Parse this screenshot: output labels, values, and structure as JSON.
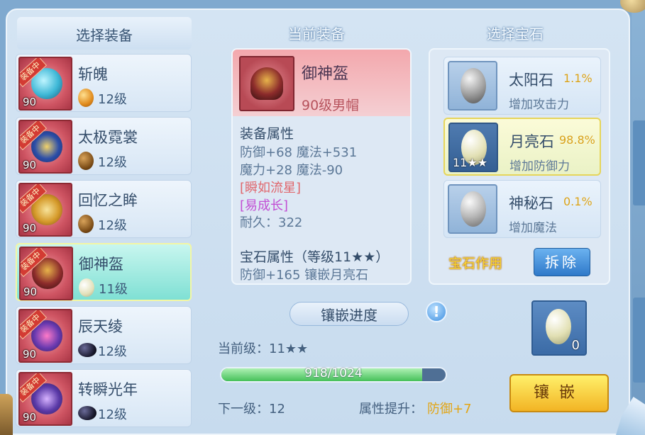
{
  "left_panel": {
    "title": "选择装备",
    "items": [
      {
        "name": "斩魄",
        "badge": "装备中",
        "item_level": "90",
        "gem_level": "12级",
        "gem": "amber-gem-icon"
      },
      {
        "name": "太极霓裳",
        "badge": "装备中",
        "item_level": "90",
        "gem_level": "12级",
        "gem": "brown-gem-icon"
      },
      {
        "name": "回忆之眸",
        "badge": "装备中",
        "item_level": "90",
        "gem_level": "12级",
        "gem": "brown-gem-icon"
      },
      {
        "name": "御神盔",
        "badge": "装备中",
        "item_level": "90",
        "gem_level": "11级",
        "gem": "moonstone-icon",
        "selected": true
      },
      {
        "name": "辰天绫",
        "badge": "装备中",
        "item_level": "90",
        "gem_level": "12级",
        "gem": "black-gem-icon"
      },
      {
        "name": "转瞬光年",
        "badge": "装备中",
        "item_level": "90",
        "gem_level": "12级",
        "gem": "black-gem-icon"
      }
    ]
  },
  "current_equip": {
    "header": "当前装备",
    "name": "御神盔",
    "subtitle": "90级男帽",
    "attr_title": "装备属性",
    "attr_line1": "防御+68 魔法+531",
    "attr_line2": "魔力+28 魔法-90",
    "special1": "[瞬如流星]",
    "special2": "[易成长]",
    "durability": "耐久：322",
    "gem_attr_title": "宝石属性（等级11★★）",
    "gem_attr_line": "防御+165 镶嵌月亮石"
  },
  "gem_panel": {
    "header": "选择宝石",
    "gems": [
      {
        "name": "太阳石",
        "pct": "1.1%",
        "desc": "增加攻击力"
      },
      {
        "name": "月亮石",
        "pct": "98.8%",
        "desc": "增加防御力",
        "slot_label": "11★★",
        "selected": true
      },
      {
        "name": "神秘石",
        "pct": "0.1%",
        "desc": "增加魔法"
      }
    ],
    "effect_label": "宝石作用",
    "split_button": "拆除"
  },
  "progress": {
    "title": "镶嵌进度",
    "info_icon_glyph": "!",
    "current_level": "当前级：11★★",
    "bar_text": "918/1024",
    "bar_fraction": 0.896,
    "next_level": "下一级：12",
    "boost_label": "属性提升：",
    "boost_value": "防御+7",
    "stone_count": "0",
    "inlay_button": "镶嵌"
  },
  "colors": {
    "accent_gold": "#f2b424",
    "selected_teal": "#7fe0d4",
    "badge_red": "#d33b33",
    "progress_green": "#45c05a"
  }
}
